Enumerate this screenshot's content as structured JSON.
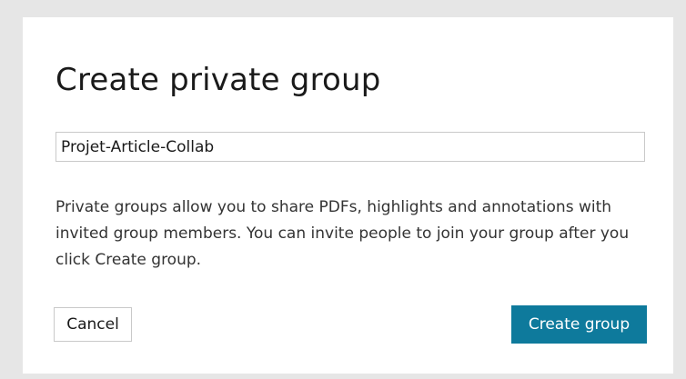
{
  "dialog": {
    "title": "Create private group",
    "group_name_value": "Projet-Article-Collab",
    "description": "Private groups allow you to share PDFs, highlights and annotations with invited group members. You can invite people to join your group after you click Create group.",
    "cancel_label": "Cancel",
    "create_label": "Create group"
  },
  "colors": {
    "background": "#e6e6e6",
    "dialog": "#ffffff",
    "primary_button": "#0e7a9c"
  }
}
